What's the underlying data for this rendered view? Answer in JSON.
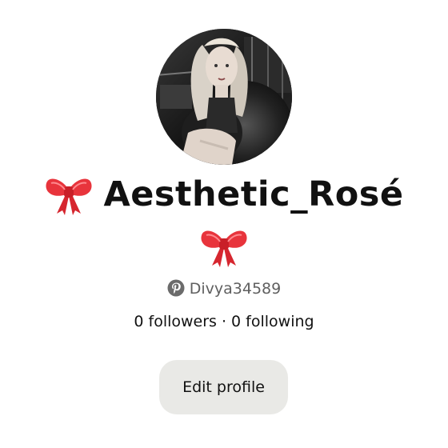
{
  "profile": {
    "display_name": "Aesthetic_Rosé",
    "handle": "Divya34589",
    "stats": "0 followers · 0 following",
    "edit_button_label": "Edit profile"
  },
  "icons": {
    "name_prefix": "ribbon-bow-icon",
    "second_line": "ribbon-bow-icon",
    "handle": "pinterest-logo-icon"
  },
  "colors": {
    "bow_red": "#e8343c",
    "handle_gray": "#5f5f5f",
    "button_bg": "#e9e9e6",
    "text": "#111111"
  }
}
